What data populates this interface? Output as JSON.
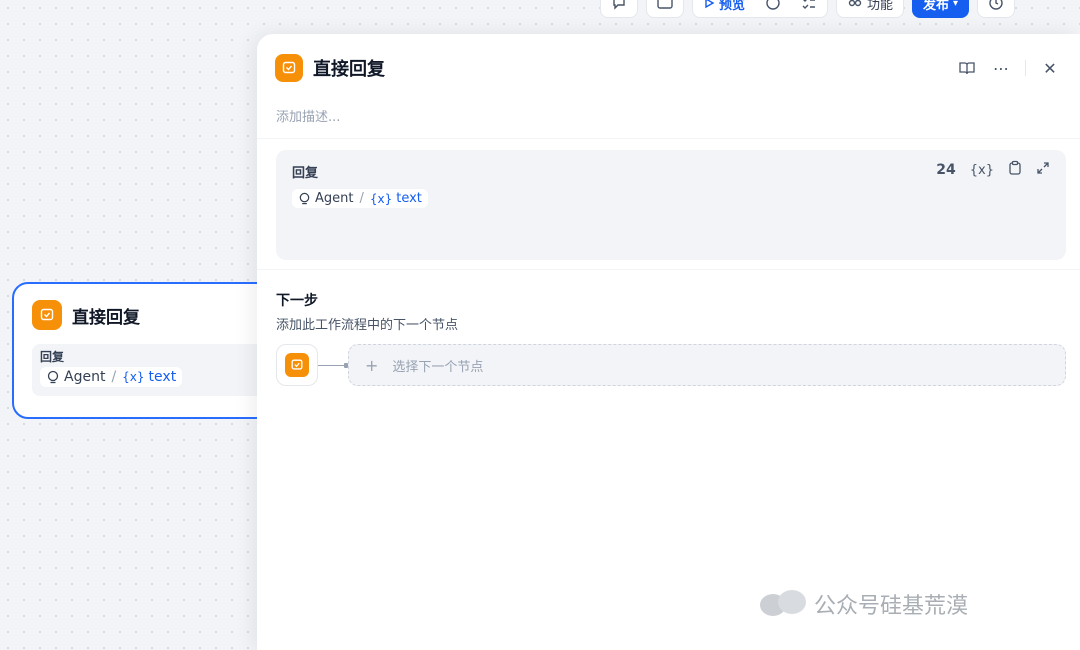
{
  "toolbar": {
    "preview_label": "预览",
    "features_label": "功能",
    "publish_label": "发布"
  },
  "canvas_node": {
    "title": "直接回复",
    "field_label": "回复",
    "var_source": "Agent",
    "var_name": "text"
  },
  "panel": {
    "title": "直接回复",
    "description_placeholder": "添加描述...",
    "reply": {
      "label": "回复",
      "char_count": "24",
      "var_source": "Agent",
      "var_name": "text"
    },
    "next_step": {
      "title": "下一步",
      "description": "添加此工作流程中的下一个节点",
      "select_label": "选择下一个节点"
    }
  },
  "watermark": {
    "text": "公众号硅基荒漠"
  },
  "colors": {
    "accent": "#155eef",
    "node_orange": "#f79009",
    "selected_border": "#296dff"
  }
}
